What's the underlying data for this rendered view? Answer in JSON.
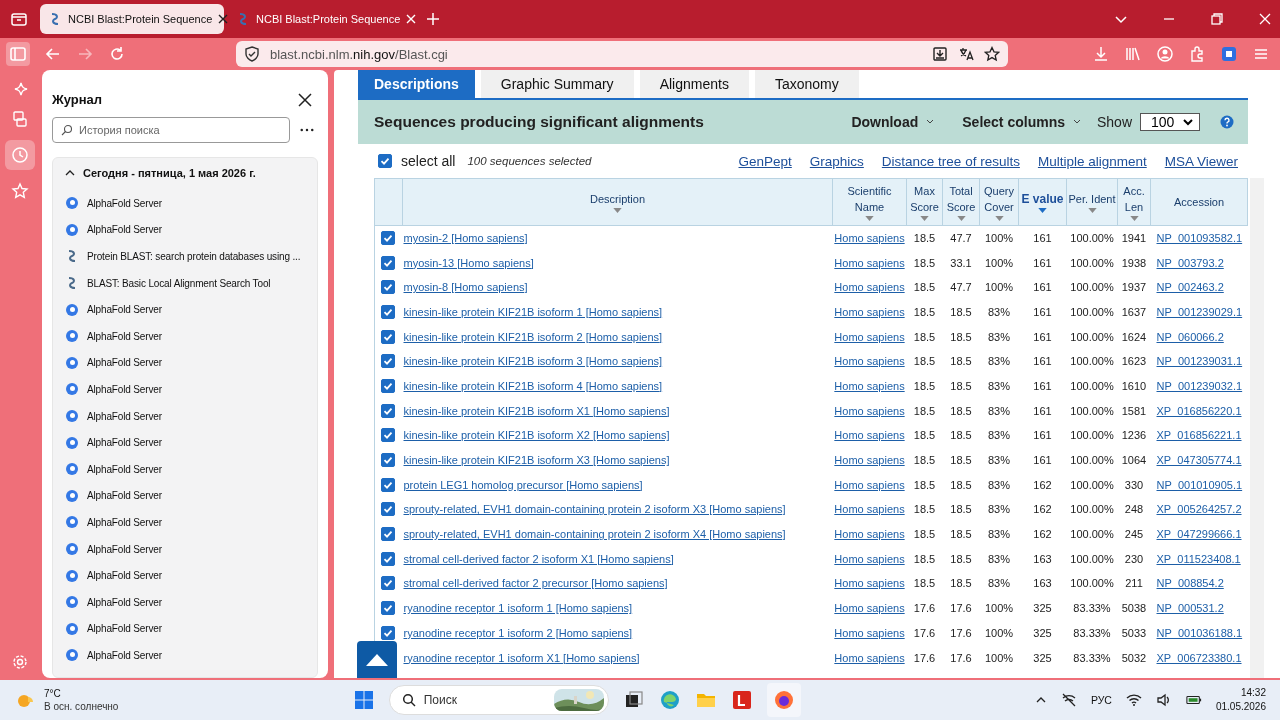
{
  "browser": {
    "tabs": [
      {
        "title": "NCBI Blast:Protein Sequence",
        "selected": true
      },
      {
        "title": "NCBI Blast:Protein Sequence",
        "selected": false
      }
    ],
    "url": "blast.ncbi.nlm.**nih.gov**/Blast.cgi"
  },
  "sidebar": {
    "title": "Журнал",
    "search": {
      "placeholder": "История поиска"
    },
    "group": {
      "label": "Сегодня - пятница, 1 мая 2026 г.",
      "expanded": true
    },
    "items": [
      {
        "title": "AlphaFold Server",
        "kind": "alphafold"
      },
      {
        "title": "AlphaFold Server",
        "kind": "alphafold"
      },
      {
        "title": "Protein BLAST: search protein databases using ...",
        "kind": "blast"
      },
      {
        "title": "BLAST: Basic Local Alignment Search Tool",
        "kind": "blast"
      },
      {
        "title": "AlphaFold Server",
        "kind": "alphafold"
      },
      {
        "title": "AlphaFold Server",
        "kind": "alphafold"
      },
      {
        "title": "AlphaFold Server",
        "kind": "alphafold"
      },
      {
        "title": "AlphaFold Server",
        "kind": "alphafold"
      },
      {
        "title": "AlphaFold Server",
        "kind": "alphafold"
      },
      {
        "title": "AlphaFold Server",
        "kind": "alphafold"
      },
      {
        "title": "AlphaFold Server",
        "kind": "alphafold"
      },
      {
        "title": "AlphaFold Server",
        "kind": "alphafold"
      },
      {
        "title": "AlphaFold Server",
        "kind": "alphafold"
      },
      {
        "title": "AlphaFold Server",
        "kind": "alphafold"
      },
      {
        "title": "AlphaFold Server",
        "kind": "alphafold"
      },
      {
        "title": "AlphaFold Server",
        "kind": "alphafold"
      },
      {
        "title": "AlphaFold Server",
        "kind": "alphafold"
      },
      {
        "title": "AlphaFold Server",
        "kind": "alphafold"
      }
    ]
  },
  "page": {
    "tabs": [
      {
        "label": "Descriptions",
        "selected": true
      },
      {
        "label": "Graphic Summary",
        "selected": false
      },
      {
        "label": "Alignments",
        "selected": false
      },
      {
        "label": "Taxonomy",
        "selected": false
      }
    ],
    "title": "Sequences producing significant alignments",
    "download": "Download",
    "select_columns": "Select columns",
    "show_label": "Show",
    "show_value": "100",
    "select_all": {
      "label": "select all",
      "checked": true
    },
    "selected_count": "100 sequences selected",
    "links": [
      "GenPept",
      "Graphics",
      "Distance tree of results",
      "Multiple alignment",
      "MSA Viewer"
    ],
    "columns": [
      {
        "label": "Description",
        "sorted": false
      },
      {
        "label": "Scientific Name",
        "sorted": false
      },
      {
        "label": "Max Score",
        "sorted": false
      },
      {
        "label": "Total Score",
        "sorted": false
      },
      {
        "label": "Query Cover",
        "sorted": false
      },
      {
        "label": "E value",
        "sorted": true
      },
      {
        "label": "Per. Ident",
        "sorted": false
      },
      {
        "label": "Acc. Len",
        "sorted": false
      },
      {
        "label": "Accession",
        "sorted": false
      }
    ],
    "rows": [
      {
        "checked": true,
        "cells": [
          "myosin-2 [Homo sapiens]",
          "Homo sapiens",
          "18.5",
          "47.7",
          "100%",
          "161",
          "100.00%",
          "1941",
          "NP_001093582.1"
        ]
      },
      {
        "checked": true,
        "cells": [
          "myosin-13 [Homo sapiens]",
          "Homo sapiens",
          "18.5",
          "33.1",
          "100%",
          "161",
          "100.00%",
          "1938",
          "NP_003793.2"
        ]
      },
      {
        "checked": true,
        "cells": [
          "myosin-8 [Homo sapiens]",
          "Homo sapiens",
          "18.5",
          "47.7",
          "100%",
          "161",
          "100.00%",
          "1937",
          "NP_002463.2"
        ]
      },
      {
        "checked": true,
        "cells": [
          "kinesin-like protein KIF21B isoform 1 [Homo sapiens]",
          "Homo sapiens",
          "18.5",
          "18.5",
          "83%",
          "161",
          "100.00%",
          "1637",
          "NP_001239029.1"
        ]
      },
      {
        "checked": true,
        "cells": [
          "kinesin-like protein KIF21B isoform 2 [Homo sapiens]",
          "Homo sapiens",
          "18.5",
          "18.5",
          "83%",
          "161",
          "100.00%",
          "1624",
          "NP_060066.2"
        ]
      },
      {
        "checked": true,
        "cells": [
          "kinesin-like protein KIF21B isoform 3 [Homo sapiens]",
          "Homo sapiens",
          "18.5",
          "18.5",
          "83%",
          "161",
          "100.00%",
          "1623",
          "NP_001239031.1"
        ]
      },
      {
        "checked": true,
        "cells": [
          "kinesin-like protein KIF21B isoform 4 [Homo sapiens]",
          "Homo sapiens",
          "18.5",
          "18.5",
          "83%",
          "161",
          "100.00%",
          "1610",
          "NP_001239032.1"
        ]
      },
      {
        "checked": true,
        "cells": [
          "kinesin-like protein KIF21B isoform X1 [Homo sapiens]",
          "Homo sapiens",
          "18.5",
          "18.5",
          "83%",
          "161",
          "100.00%",
          "1581",
          "XP_016856220.1"
        ]
      },
      {
        "checked": true,
        "cells": [
          "kinesin-like protein KIF21B isoform X2 [Homo sapiens]",
          "Homo sapiens",
          "18.5",
          "18.5",
          "83%",
          "161",
          "100.00%",
          "1236",
          "XP_016856221.1"
        ]
      },
      {
        "checked": true,
        "cells": [
          "kinesin-like protein KIF21B isoform X3 [Homo sapiens]",
          "Homo sapiens",
          "18.5",
          "18.5",
          "83%",
          "161",
          "100.00%",
          "1064",
          "XP_047305774.1"
        ]
      },
      {
        "checked": true,
        "cells": [
          "protein LEG1 homolog precursor [Homo sapiens]",
          "Homo sapiens",
          "18.5",
          "18.5",
          "83%",
          "162",
          "100.00%",
          "330",
          "NP_001010905.1"
        ]
      },
      {
        "checked": true,
        "cells": [
          "sprouty-related, EVH1 domain-containing protein 2 isoform X3 [Homo sapiens]",
          "Homo sapiens",
          "18.5",
          "18.5",
          "83%",
          "162",
          "100.00%",
          "248",
          "XP_005264257.2"
        ]
      },
      {
        "checked": true,
        "cells": [
          "sprouty-related, EVH1 domain-containing protein 2 isoform X4 [Homo sapiens]",
          "Homo sapiens",
          "18.5",
          "18.5",
          "83%",
          "162",
          "100.00%",
          "245",
          "XP_047299666.1"
        ]
      },
      {
        "checked": true,
        "cells": [
          "stromal cell-derived factor 2 isoform X1 [Homo sapiens]",
          "Homo sapiens",
          "18.5",
          "18.5",
          "83%",
          "163",
          "100.00%",
          "230",
          "XP_011523408.1"
        ]
      },
      {
        "checked": true,
        "cells": [
          "stromal cell-derived factor 2 precursor [Homo sapiens]",
          "Homo sapiens",
          "18.5",
          "18.5",
          "83%",
          "163",
          "100.00%",
          "211",
          "NP_008854.2"
        ]
      },
      {
        "checked": true,
        "cells": [
          "ryanodine receptor 1 isoform 1 [Homo sapiens]",
          "Homo sapiens",
          "17.6",
          "17.6",
          "100%",
          "325",
          "83.33%",
          "5038",
          "NP_000531.2"
        ]
      },
      {
        "checked": true,
        "cells": [
          "ryanodine receptor 1 isoform 2 [Homo sapiens]",
          "Homo sapiens",
          "17.6",
          "17.6",
          "100%",
          "325",
          "83.33%",
          "5033",
          "NP_001036188.1"
        ]
      },
      {
        "cells": [
          "ryanodine receptor 1 isoform X1 [Homo sapiens]",
          "Homo sapiens",
          "17.6",
          "17.6",
          "100%",
          "325",
          "83.33%",
          "5032",
          "XP_006723380.1"
        ]
      }
    ]
  },
  "taskbar": {
    "temperature": "7°C",
    "weather": "В осн. солнечно",
    "search": {
      "placeholder": "Поиск"
    },
    "language": "РУС",
    "time": "14:32",
    "date": "01.05.2026"
  }
}
